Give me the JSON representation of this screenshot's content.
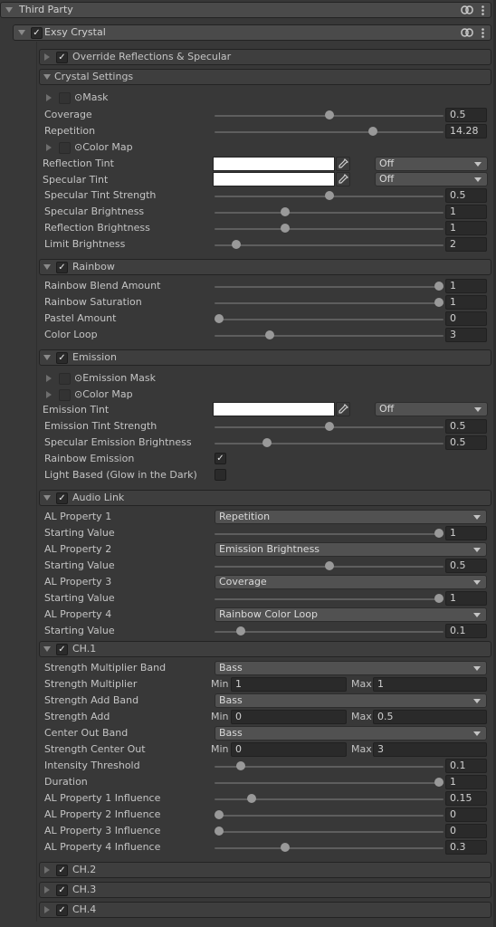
{
  "panel": {
    "title": "Third Party",
    "component": "Exsy Crystal"
  },
  "override": {
    "label": "Override Reflections & Specular"
  },
  "crystal": {
    "title": "Crystal Settings",
    "mask_label": "Mask",
    "coverage": {
      "label": "Coverage",
      "value": "0.5",
      "fraction": 0.5
    },
    "repetition": {
      "label": "Repetition",
      "value": "14.28",
      "fraction": 0.7
    },
    "color_map_label": "Color Map",
    "reflection_tint": {
      "label": "Reflection Tint",
      "color": "#ffffff",
      "mode": "Off"
    },
    "specular_tint": {
      "label": "Specular Tint",
      "color": "#ffffff",
      "mode": "Off"
    },
    "specular_tint_strength": {
      "label": "Specular Tint Strength",
      "value": "0.5",
      "fraction": 0.5
    },
    "specular_brightness": {
      "label": "Specular Brightness",
      "value": "1",
      "fraction": 0.3
    },
    "reflection_brightness": {
      "label": "Reflection Brightness",
      "value": "1",
      "fraction": 0.3
    },
    "limit_brightness": {
      "label": "Limit Brightness",
      "value": "2",
      "fraction": 0.08
    }
  },
  "rainbow": {
    "title": "Rainbow",
    "blend_amount": {
      "label": "Rainbow Blend Amount",
      "value": "1",
      "fraction": 1.0
    },
    "saturation": {
      "label": "Rainbow Saturation",
      "value": "1",
      "fraction": 1.0
    },
    "pastel_amount": {
      "label": "Pastel Amount",
      "value": "0",
      "fraction": 0.0
    },
    "color_loop": {
      "label": "Color Loop",
      "value": "3",
      "fraction": 0.23
    }
  },
  "emission": {
    "title": "Emission",
    "mask_label": "Emission Mask",
    "color_map_label": "Color Map",
    "tint": {
      "label": "Emission Tint",
      "color": "#ffffff",
      "mode": "Off"
    },
    "tint_strength": {
      "label": "Emission Tint Strength",
      "value": "0.5",
      "fraction": 0.5
    },
    "specular_emission_brightness": {
      "label": "Specular Emission Brightness",
      "value": "0.5",
      "fraction": 0.22
    },
    "rainbow_emission": {
      "label": "Rainbow Emission",
      "checked": true
    },
    "light_based": {
      "label": "Light Based (Glow in the Dark)",
      "checked": false
    }
  },
  "audio_link": {
    "title": "Audio Link",
    "properties": [
      {
        "label": "AL Property 1",
        "option": "Repetition",
        "start_label": "Starting Value",
        "start_value": "1",
        "fraction": 1.0
      },
      {
        "label": "AL Property 2",
        "option": "Emission Brightness",
        "start_label": "Starting Value",
        "start_value": "0.5",
        "fraction": 0.5
      },
      {
        "label": "AL Property 3",
        "option": "Coverage",
        "start_label": "Starting Value",
        "start_value": "1",
        "fraction": 1.0
      },
      {
        "label": "AL Property 4",
        "option": "Rainbow Color Loop",
        "start_label": "Starting Value",
        "start_value": "0.1",
        "fraction": 0.1
      }
    ],
    "ch1": {
      "title": "CH.1",
      "strength_multiplier_band": {
        "label": "Strength Multiplier Band",
        "option": "Bass"
      },
      "strength_multiplier": {
        "label": "Strength Multiplier",
        "min_label": "Min",
        "min": "1",
        "max_label": "Max",
        "max": "1"
      },
      "strength_add_band": {
        "label": "Strength Add Band",
        "option": "Bass"
      },
      "strength_add": {
        "label": "Strength Add",
        "min_label": "Min",
        "min": "0",
        "max_label": "Max",
        "max": "0.5"
      },
      "center_out_band": {
        "label": "Center Out Band",
        "option": "Bass"
      },
      "strength_center_out": {
        "label": "Strength Center Out",
        "min_label": "Min",
        "min": "0",
        "max_label": "Max",
        "max": "3"
      },
      "intensity_threshold": {
        "label": "Intensity Threshold",
        "value": "0.1",
        "fraction": 0.1
      },
      "duration": {
        "label": "Duration",
        "value": "1",
        "fraction": 1.0
      },
      "al1_influence": {
        "label": "AL Property 1 Influence",
        "value": "0.15",
        "fraction": 0.15
      },
      "al2_influence": {
        "label": "AL Property 2 Influence",
        "value": "0",
        "fraction": 0.0
      },
      "al3_influence": {
        "label": "AL Property 3 Influence",
        "value": "0",
        "fraction": 0.0
      },
      "al4_influence": {
        "label": "AL Property 4 Influence",
        "value": "0.3",
        "fraction": 0.3
      }
    },
    "ch2": {
      "title": "CH.2"
    },
    "ch3": {
      "title": "CH.3"
    },
    "ch4": {
      "title": "CH.4"
    }
  },
  "icons": {
    "link": "link-icon",
    "menu": "kebab-menu-icon",
    "eyedropper": "eyedropper-icon",
    "check": "✓"
  },
  "colors": {
    "background": "#383838",
    "header": "#3e3e3e",
    "field": "#2a2a2a",
    "dropdown": "#515151",
    "text": "#c4c4c4"
  }
}
